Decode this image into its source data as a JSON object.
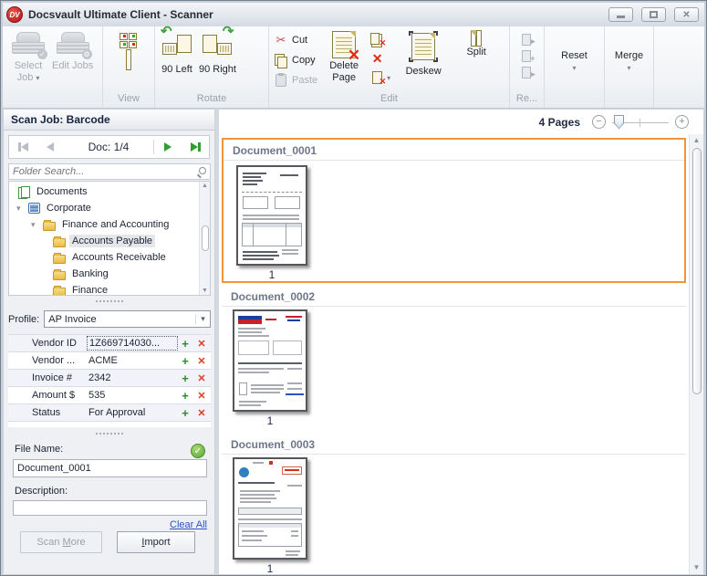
{
  "window": {
    "title": "Docsvault Ultimate Client - Scanner",
    "logo_text": "DV"
  },
  "colors": {
    "accent_orange": "#F0953C",
    "link_blue": "#2B51C8",
    "success_green": "#3DA23D",
    "danger_red": "#E02B12",
    "brand_red": "#B01218"
  },
  "icons": {
    "expander": "▾",
    "close": "✕",
    "cut": "✂",
    "rotate_left_arrow": "↶",
    "rotate_right_arrow": "↷",
    "delete": "✕",
    "add": "+",
    "check": "✓",
    "gear": "⚙",
    "zoom_out": "−",
    "zoom_in": "+",
    "arrow_up": "▲",
    "arrow_down": "▼",
    "mini_arrow": "▸",
    "mini_plus": "+"
  },
  "toolbar": {
    "select_job": "Select Job",
    "edit_jobs": "Edit Jobs",
    "group_view": "View",
    "rotate_left": "90 Left",
    "rotate_right": "90 Right",
    "group_rotate": "Rotate",
    "cut": "Cut",
    "copy": "Copy",
    "paste": "Paste",
    "delete_page": "Delete Page",
    "deskew": "Deskew",
    "split": "Split",
    "group_edit": "Edit",
    "group_rescan": "Re...",
    "reset": "Reset",
    "merge": "Merge"
  },
  "scan": {
    "header": "Scan Job: Barcode",
    "doc_counter": "Doc: 1/4",
    "search_placeholder": "Folder Search...",
    "tree": [
      {
        "label": "Documents"
      },
      {
        "label": "Corporate"
      },
      {
        "label": "Finance and Accounting"
      },
      {
        "label": "Accounts Payable"
      },
      {
        "label": "Accounts Receivable"
      },
      {
        "label": "Banking"
      },
      {
        "label": "Finance"
      }
    ],
    "profile_label": "Profile:",
    "profile_value": "AP Invoice",
    "fields": [
      {
        "label": "Vendor ID",
        "value": "1Z669714030..."
      },
      {
        "label": "Vendor ...",
        "value": "ACME"
      },
      {
        "label": "Invoice #",
        "value": "2342"
      },
      {
        "label": "Amount $",
        "value": "535"
      },
      {
        "label": "Status",
        "value": "For Approval"
      }
    ],
    "file_name_label": "File Name:",
    "file_name_value": "Document_0001",
    "description_label": "Description:",
    "description_value": "",
    "clear_all": "Clear All",
    "scan_more": {
      "pre": "Scan ",
      "accel": "M",
      "post": "ore"
    },
    "import_btn": {
      "pre": "",
      "accel": "I",
      "post": "mport"
    }
  },
  "pages": {
    "count": "4 Pages",
    "documents": [
      {
        "title": "Document_0001",
        "page": "1"
      },
      {
        "title": "Document_0002",
        "page": "1"
      },
      {
        "title": "Document_0003",
        "page": "1"
      }
    ]
  }
}
